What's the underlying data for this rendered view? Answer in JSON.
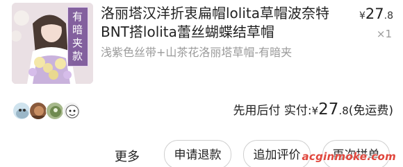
{
  "product": {
    "title": "洛丽塔汉洋折衷扁帽lolita草帽波奈特BNT搭lolita蕾丝蝴蝶结草帽",
    "variant": "浅紫色丝带+山茶花洛丽塔草帽-有暗夹",
    "thumbnail_tag": "有暗夹款",
    "price_symbol": "¥",
    "price_int": "27",
    "price_dec": ".8",
    "quantity": "×1"
  },
  "summary": {
    "label": "先用后付 实付:",
    "price_symbol": "¥",
    "price_int": "27",
    "price_dec": ".8",
    "shipping": "(免运费)"
  },
  "actions": {
    "more": "更多",
    "refund": "申请退款",
    "review": "追加评价",
    "rebuy": "再次拼单"
  },
  "watermark": "acginmoke.com",
  "colors": {
    "variant_text": "#9a9a9a",
    "button_border": "#cfcfcf",
    "watermark": "#e0463c",
    "thumb_tag_bg": "#785296"
  }
}
